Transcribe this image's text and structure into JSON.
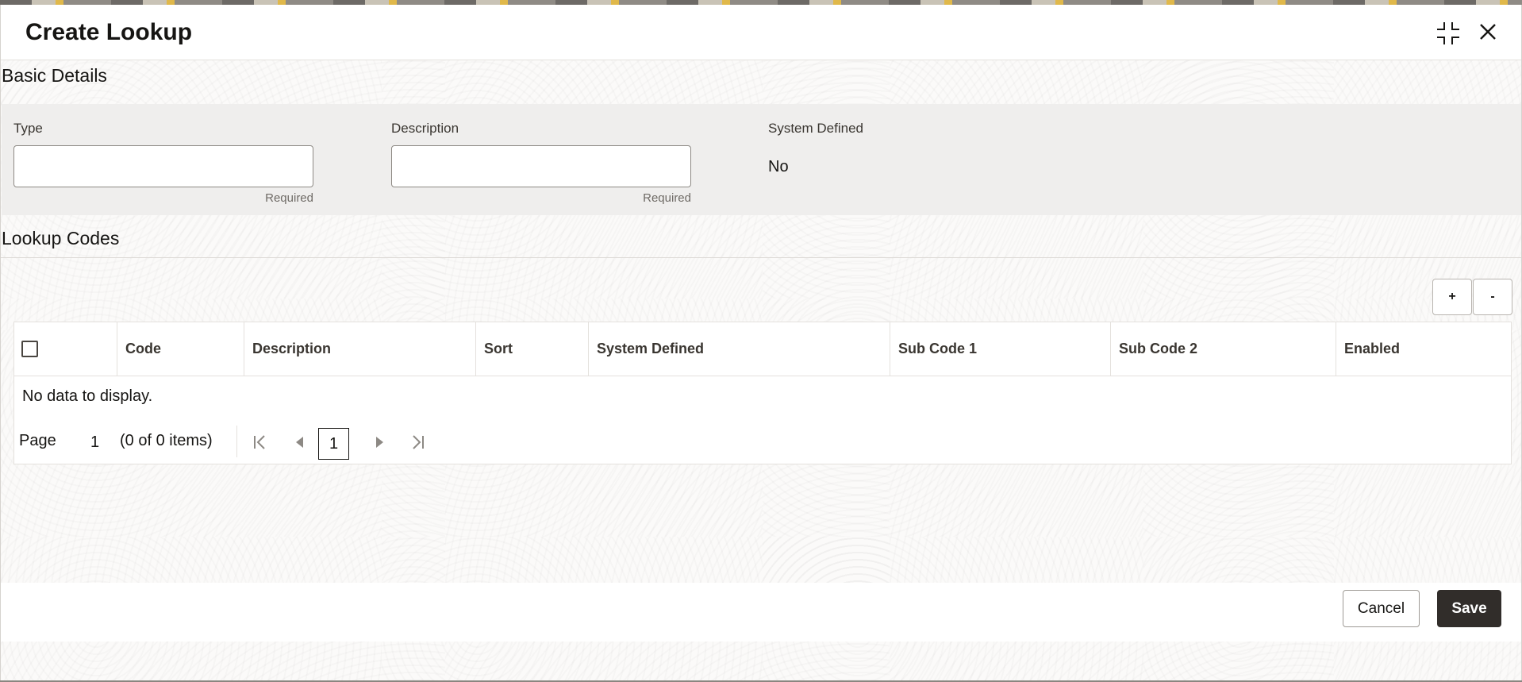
{
  "dialog": {
    "title": "Create Lookup",
    "minimize_icon": "compress-icon",
    "close_icon": "close-icon"
  },
  "basic_details": {
    "section_title": "Basic Details",
    "type": {
      "label": "Type",
      "value": "",
      "hint": "Required"
    },
    "description": {
      "label": "Description",
      "value": "",
      "hint": "Required"
    },
    "system_defined": {
      "label": "System Defined",
      "value": "No"
    }
  },
  "lookup_codes": {
    "section_title": "Lookup Codes",
    "add_label": "+",
    "remove_label": "-",
    "columns": [
      "Code",
      "Description",
      "Sort",
      "System Defined",
      "Sub Code 1",
      "Sub Code 2",
      "Enabled"
    ],
    "rows": [],
    "empty_message": "No data to display.",
    "pager": {
      "page_label": "Page",
      "page_number": "1",
      "item_count": "(0 of 0 items)",
      "current_page": "1"
    }
  },
  "footer": {
    "cancel_label": "Cancel",
    "save_label": "Save"
  }
}
